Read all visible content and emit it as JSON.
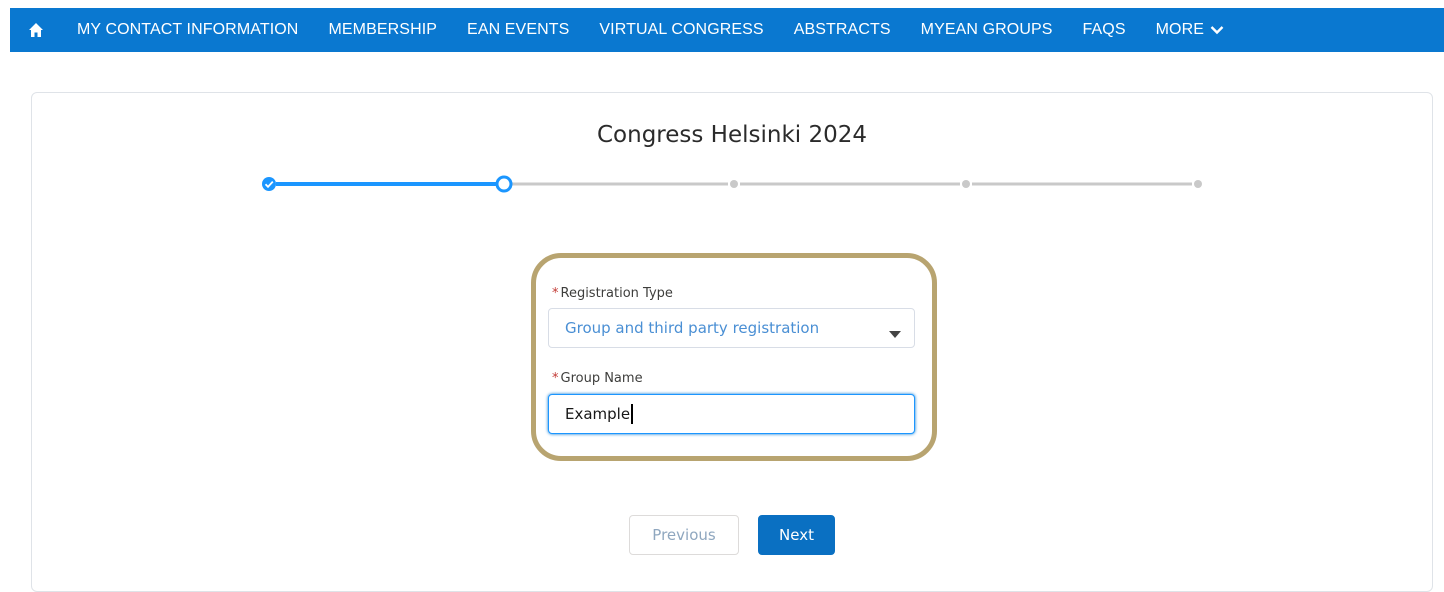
{
  "nav": {
    "home_icon": "home-icon",
    "items": [
      {
        "label": "MY CONTACT INFORMATION"
      },
      {
        "label": "MEMBERSHIP"
      },
      {
        "label": "EAN EVENTS"
      },
      {
        "label": "VIRTUAL CONGRESS"
      },
      {
        "label": "ABSTRACTS"
      },
      {
        "label": "MYEAN GROUPS"
      },
      {
        "label": "FAQS"
      },
      {
        "label": "MORE"
      }
    ],
    "more_icon": "chevron-down-icon"
  },
  "page": {
    "title": "Congress Helsinki 2024",
    "progress": {
      "total_steps": 5,
      "current_step": 2,
      "completed_steps": 1
    }
  },
  "form": {
    "registration_type": {
      "required_marker": "*",
      "label": "Registration Type",
      "value": "Group and third party registration"
    },
    "group_name": {
      "required_marker": "*",
      "label": "Group Name",
      "value": "Example"
    }
  },
  "buttons": {
    "previous": "Previous",
    "next": "Next"
  },
  "colors": {
    "nav_bg": "#0a78d0",
    "accent": "#1b96ff",
    "highlight_border": "#b8a470",
    "next_button": "#0a70c2"
  }
}
